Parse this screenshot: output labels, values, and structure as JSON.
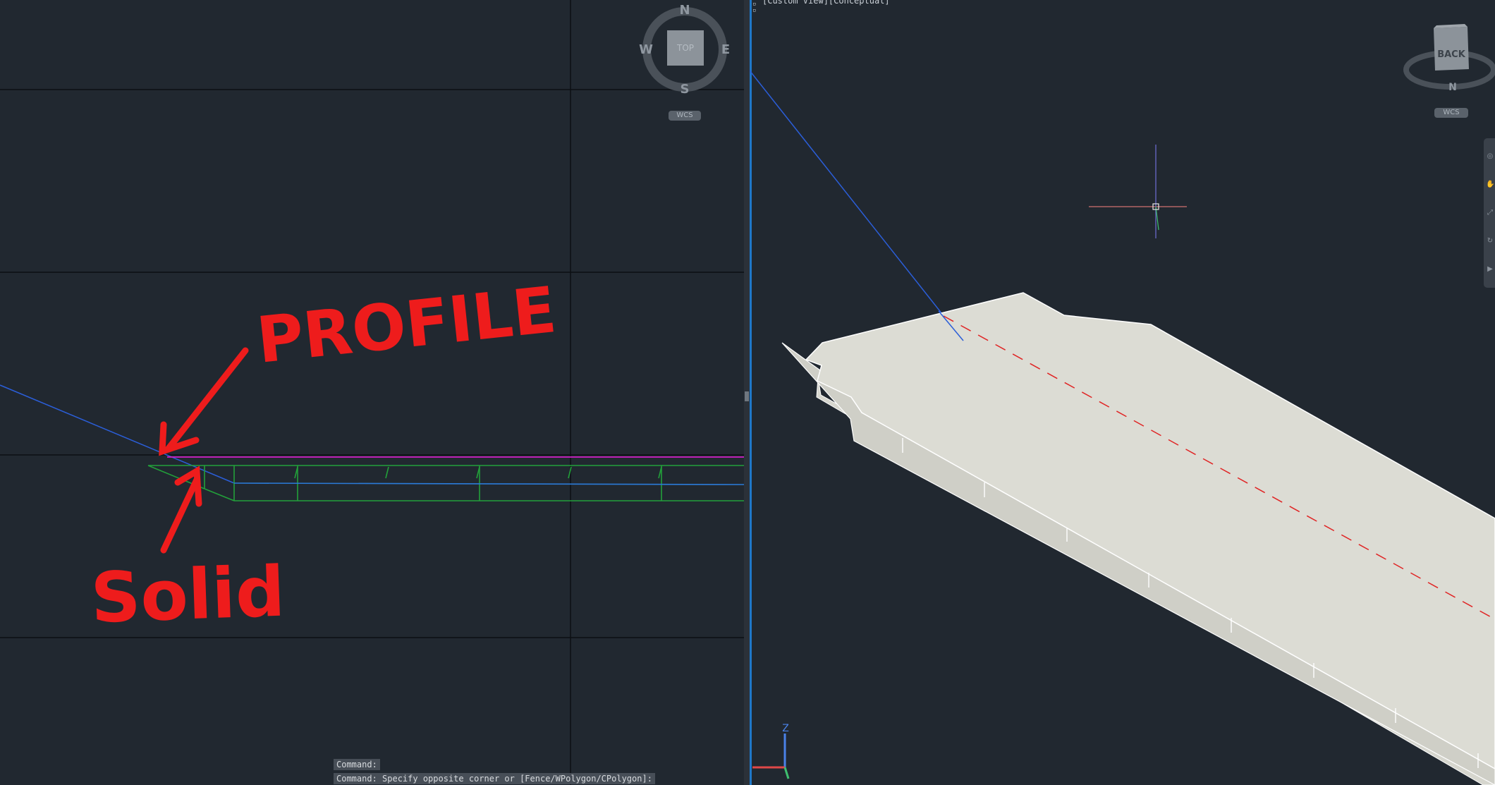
{
  "left_viewport": {
    "viewcube": {
      "face_label": "TOP",
      "north": "N",
      "south": "S",
      "east": "E",
      "west": "W"
    },
    "ucs_menu_label": "WCS",
    "annotations": {
      "profile": "PROFILE",
      "solid": "Solid"
    }
  },
  "right_viewport": {
    "viewport_label": "[Custom View][Conceptual]",
    "viewcube": {
      "face_label": "BACK",
      "compass_north": "N"
    },
    "ucs_menu_label": "WCS",
    "ucs_axis_label": "Z"
  },
  "command_line": {
    "history_1": "Command:",
    "history_2": "Command: Specify opposite corner or [Fence/WPolygon/CPolygon]:"
  },
  "colors": {
    "background": "#212830",
    "annotation_red": "#ee1c1c",
    "solid_green": "#22a03a",
    "profile_magenta": "#d21ec8",
    "alignment_blue": "#2b5ed8",
    "solid_face": "#dcdcd4"
  }
}
